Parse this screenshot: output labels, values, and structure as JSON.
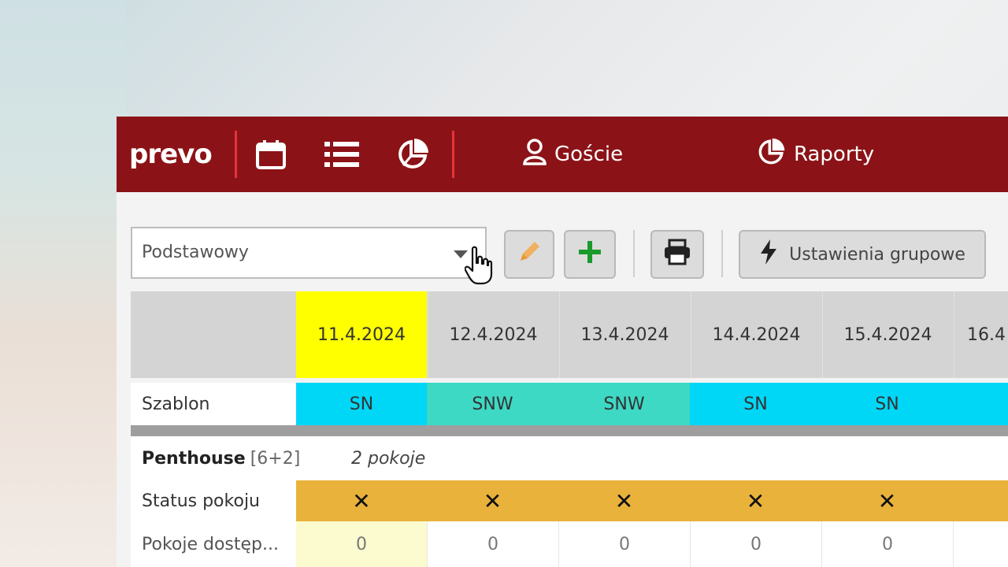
{
  "app": {
    "logo_text": "prevo",
    "nav": {
      "guests_label": "Goście",
      "reports_label": "Raporty"
    }
  },
  "toolbar": {
    "select_value": "Podstawowy",
    "group_settings_label": "Ustawienia grupowe"
  },
  "colors": {
    "brand": "#8b1317",
    "today": "#ffff00",
    "sn": "#00d7f7",
    "snw": "#3dd9c4",
    "status_unavailable": "#e9b23b",
    "available_today": "#fbfbcf"
  },
  "dates": [
    "11.4.2024",
    "12.4.2024",
    "13.4.2024",
    "14.4.2024",
    "15.4.2024",
    "16.4"
  ],
  "template_row": {
    "label": "Szablon",
    "values": [
      "SN",
      "SNW",
      "SNW",
      "SN",
      "SN",
      ""
    ]
  },
  "room_group": {
    "name": "Penthouse",
    "capacity": "[6+2]",
    "count": "2 pokoje"
  },
  "status_row": {
    "label": "Status pokoju",
    "values": [
      "✕",
      "✕",
      "✕",
      "✕",
      "✕",
      ""
    ]
  },
  "available_row": {
    "label": "Pokoje dostęp...",
    "values": [
      "0",
      "0",
      "0",
      "0",
      "0",
      ""
    ]
  },
  "icons": {
    "calendar": "calendar-icon",
    "list": "list-icon",
    "pie": "pie-chart-icon",
    "user": "user-icon",
    "edit": "pencil-icon",
    "add": "plus-icon",
    "print": "printer-icon",
    "bolt": "lightning-icon"
  }
}
